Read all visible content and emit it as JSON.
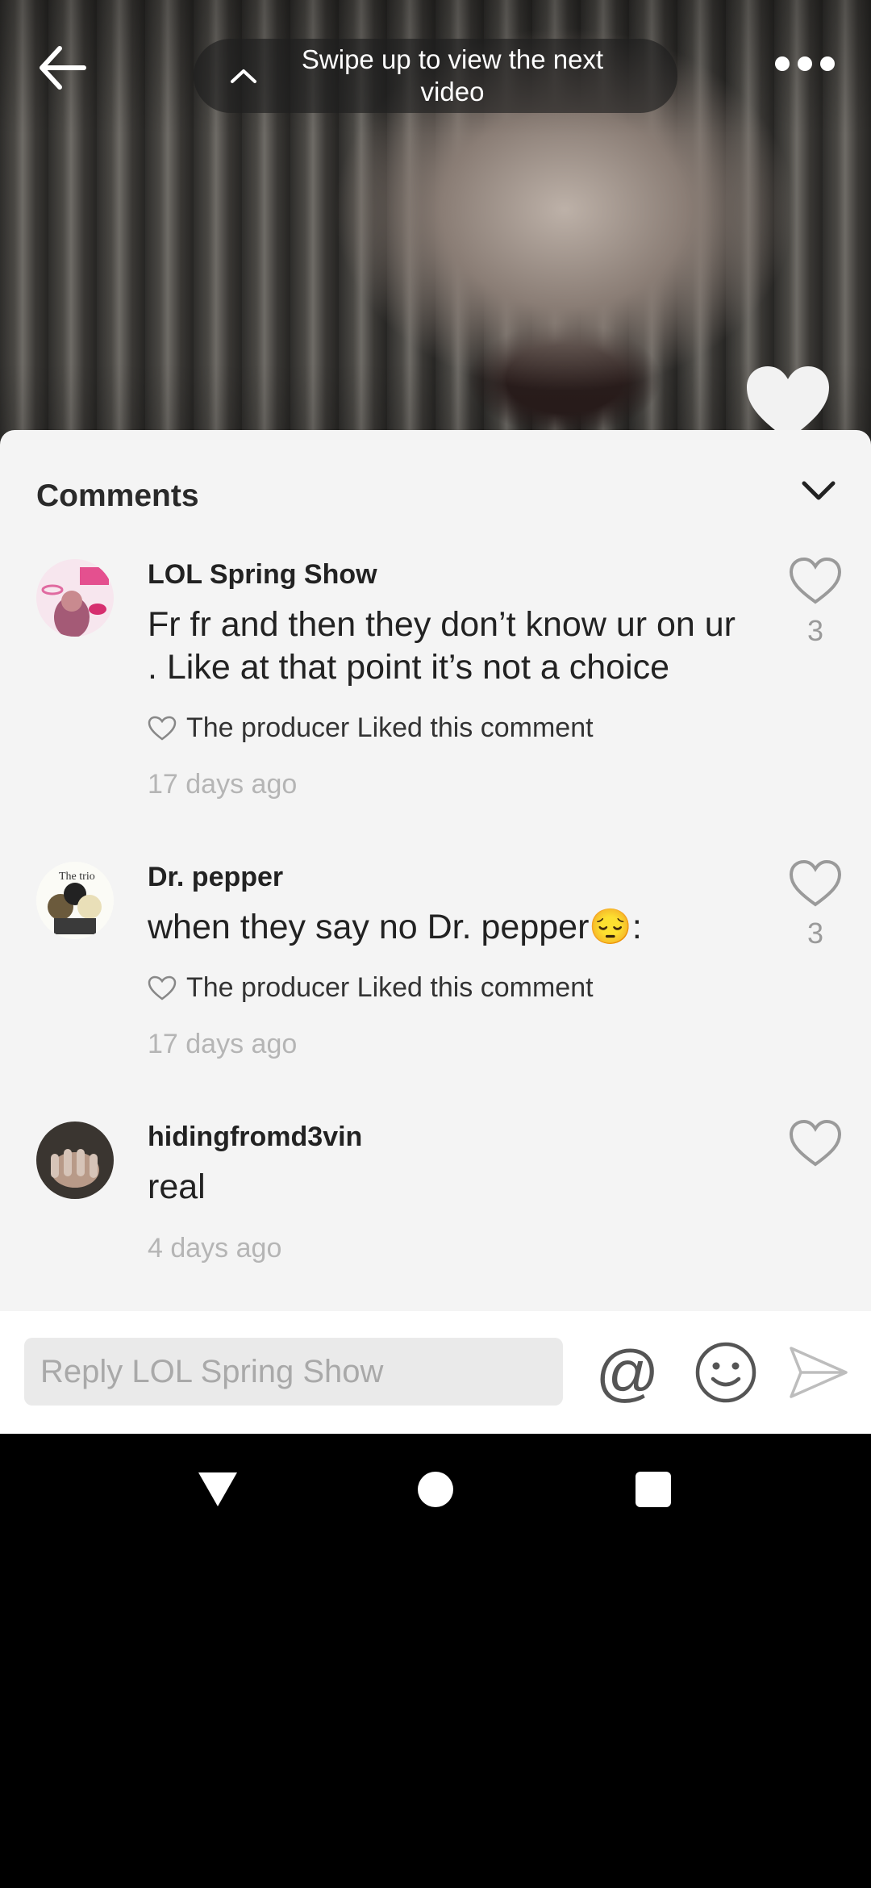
{
  "video": {
    "swipe_hint": "Swipe up to view the next video",
    "icons": {
      "back": "arrow-left-icon",
      "more": "more-dots-icon",
      "swipe": "chevron-up-icon",
      "like": "heart-icon"
    }
  },
  "comments_panel": {
    "title": "Comments",
    "collapse_icon": "chevron-down-icon",
    "comments": [
      {
        "user": "LOL Spring Show",
        "text": "Fr fr and then they don’t know ur on ur . Like at that point it’s not a choice",
        "liked_note": "The producer Liked this comment",
        "time": "17 days ago",
        "likes": "3"
      },
      {
        "user": "Dr. pepper",
        "text": "when they say no Dr. pepper😔:",
        "liked_note": "The producer Liked this comment",
        "time": "17 days ago",
        "likes": "3"
      },
      {
        "user": "hidingfromd3vin",
        "text": "real",
        "time": "4 days ago",
        "likes": ""
      }
    ]
  },
  "reply_bar": {
    "placeholder": "Reply LOL Spring Show",
    "mention_label": "@",
    "icons": {
      "emoji": "smiley-icon",
      "send": "send-icon"
    }
  },
  "system_nav": {
    "icons": {
      "back": "nav-back-icon",
      "home": "nav-home-icon",
      "recents": "nav-recents-icon"
    }
  },
  "colors": {
    "sheet_bg": "#f4f4f4",
    "time_gray": "#b5b5b5",
    "heart_outline": "#9a9a9a"
  }
}
